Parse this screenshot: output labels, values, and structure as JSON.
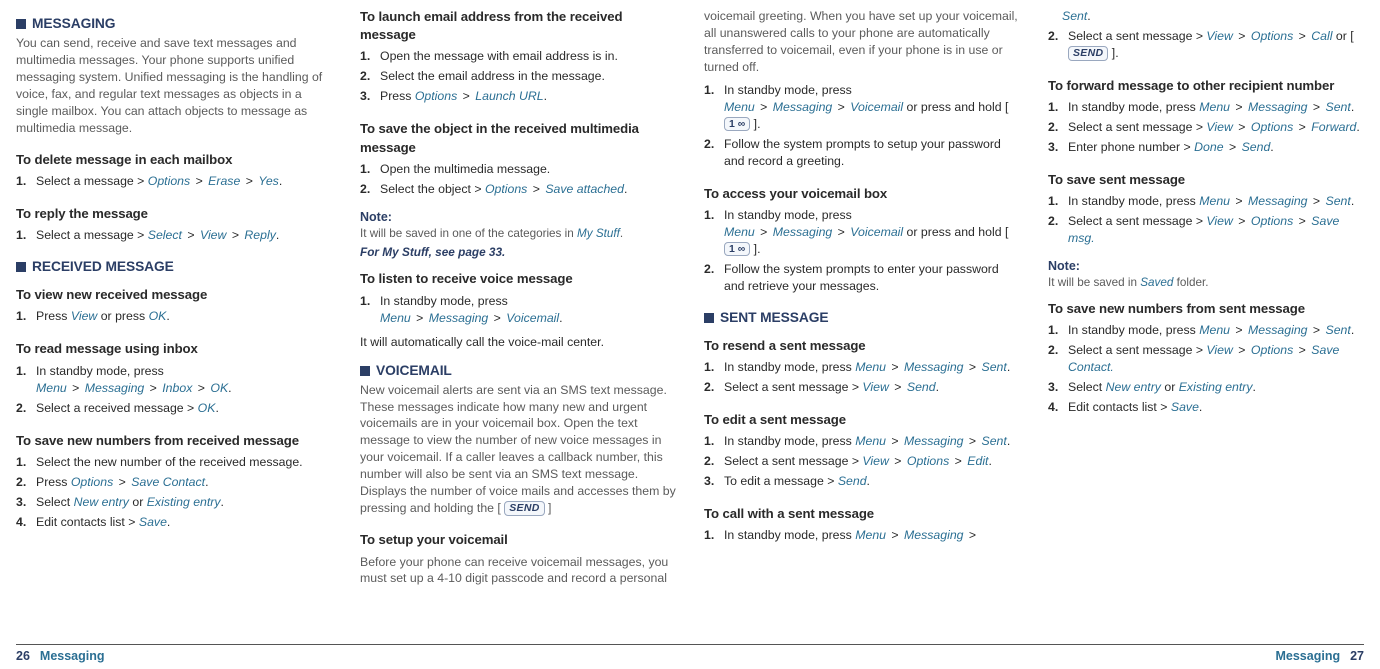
{
  "footer": {
    "left_page": "26",
    "right_page": "27",
    "label": "Messaging"
  },
  "ui": {
    "options": "Options",
    "erase": "Erase",
    "yes": "Yes",
    "select": "Select",
    "view": "View",
    "reply": "Reply",
    "ok": "OK",
    "menu": "Menu",
    "messaging": "Messaging",
    "inbox": "Inbox",
    "save_contact": "Save Contact",
    "new_entry": "New entry",
    "existing_entry": "Existing entry",
    "save": "Save",
    "launch_url": "Launch URL",
    "save_attached": "Save attached",
    "my_stuff": "My Stuff",
    "voicemail": "Voicemail",
    "send": "Send",
    "edit": "Edit",
    "call": "Call",
    "forward": "Forward",
    "done": "Done",
    "save_msg": "Save msg.",
    "save_contact2": "Save Contact.",
    "sent": "Sent",
    "saved": "Saved"
  },
  "col1": {
    "h_messaging": "MESSAGING",
    "intro": "You can send, receive and save text messages and multimedia messages. Your phone supports unified messaging system. Unified messaging is the handling of voice, fax, and regular text messages as objects in a single mailbox. You can attach objects to message as multimedia message.",
    "h_delete": "To delete message in each mailbox",
    "s_delete_1a": "Select a message > ",
    "h_reply": "To reply the message",
    "s_reply_1a": "Select a message > ",
    "h_received": "RECEIVED MESSAGE",
    "h_view_new": "To view new received message",
    "s_view_1a": "Press ",
    "s_view_1b": " or press ",
    "h_read_inbox": "To read message using inbox",
    "s_ri_1a": "In standby mode, press ",
    "s_ri_2a": "Select a received message > ",
    "h_save_num_recv": "To save new numbers from received message",
    "s_sn_1": "Select the new number of the received message.",
    "s_sn_2a": "Press ",
    "s_sn_3a": "Select ",
    "s_sn_3b": " or ",
    "s_sn_4a": "Edit contacts list > "
  },
  "col2": {
    "h_launch_email": "To launch email address from the received message",
    "s_le_1": "Open the message with email address is in.",
    "s_le_2": "Select the email address in the message.",
    "s_le_3a": "Press ",
    "h_save_obj": "To save the object in the received multimedia message",
    "s_so_1": "Open the multimedia message.",
    "s_so_2a": "Select the object > ",
    "note_lbl": "Note:",
    "note_body_a": "It will be saved in one of the categories in ",
    "xref": "For My Stuff, see page 33.",
    "h_listen": "To listen to receive voice message",
    "s_li_1a": "In standby mode, press ",
    "li_para": "It will automatically call the voice-mail center.",
    "h_voicemail": "VOICEMAIL",
    "vm_intro_a": "New voicemail alerts are sent via an SMS text message. These messages indicate how many new and urgent voicemails are in your voicemail box. Open the text message to view the number of new voice messages in your voicemail. If a caller leaves a callback number, this number will also be sent via an SMS text message. Displays the number of voice mails and accesses them by pressing and holding the [ ",
    "vm_intro_b": " ]",
    "h_setup_vm": "To setup your voicemail",
    "setup_intro": "Before your phone can receive voicemail messages, you must set up a 4-10 digit passcode and record a personal"
  },
  "col3": {
    "cont": "voicemail greeting. When you have set up your voicemail, all unanswered calls to your phone are automatically transferred to voicemail, even if your phone is in use or turned off.",
    "s_su_1a": "In standby mode, press ",
    "s_su_1b": " or press and hold [ ",
    "s_su_1c": " ].",
    "s_su_2": "Follow the system prompts to setup your password and record a greeting.",
    "h_access_vm": "To access your voicemail box",
    "s_av_1a": "In standby mode, press ",
    "s_av_1b": " or press and hold [ ",
    "s_av_1c": " ].",
    "s_av_2": "Follow the system prompts to enter your password and retrieve your messages.",
    "h_sent": "SENT MESSAGE",
    "h_resend": "To resend a sent message",
    "s_rs_1a": "In standby mode, press ",
    "s_rs_2a": "Select a sent message > ",
    "h_edit_sent": "To edit a sent message",
    "s_es_1a": "In standby mode, press ",
    "s_es_2a": "Select a sent message > ",
    "s_es_3a": "To edit a message > ",
    "h_call_sent": "To call with a sent message",
    "s_cs_1a": "In standby mode, press "
  },
  "col4": {
    "s_cs_2a": "Select a sent message > ",
    "s_cs_2b": " or [ ",
    "s_cs_2c": " ].",
    "h_fwd": "To forward message to other recipient number",
    "s_fw_1a": "In standby mode, press ",
    "s_fw_2a": "Select a sent message > ",
    "s_fw_3a": "Enter phone number > ",
    "h_save_sent": "To save sent message",
    "s_ss_1a": "In standby mode, press ",
    "s_ss_2a": "Select a sent message > ",
    "note_lbl": "Note:",
    "note_body_a": "It will be saved in ",
    "note_body_b": " folder.",
    "h_save_num_sent": "To save new numbers from sent message",
    "s_sns_1a": "In standby mode, press ",
    "s_sns_2a": "Select a sent message > ",
    "s_sns_3a": "Select ",
    "s_sns_3b": " or ",
    "s_sns_4a": "Edit contacts list > "
  }
}
